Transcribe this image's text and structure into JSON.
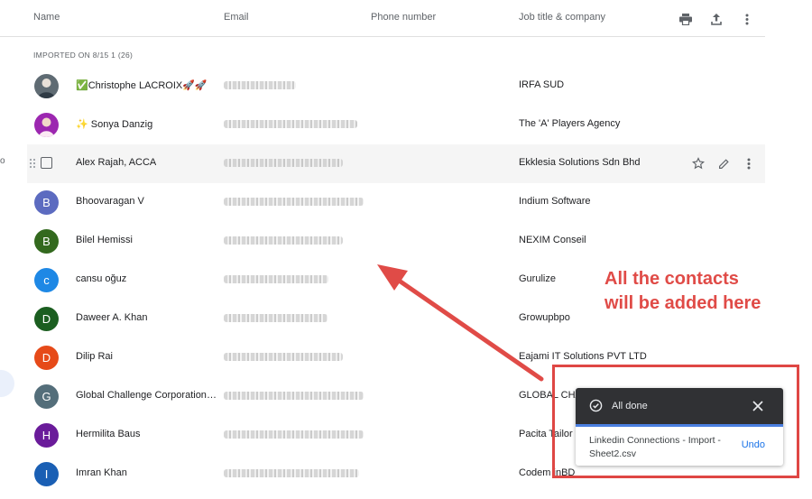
{
  "header": {
    "name": "Name",
    "email": "Email",
    "phone": "Phone number",
    "job": "Job title & company",
    "icons": [
      "print-icon",
      "export-icon",
      "more-vert-icon"
    ]
  },
  "section_label": "IMPORTED ON 8/15 1 (26)",
  "contacts": [
    {
      "initial": "",
      "name": "✅Christophe LACROIX🚀🚀",
      "job": "IRFA SUD",
      "avatar_color": "#5f6b73",
      "photo": true
    },
    {
      "initial": "",
      "name": "✨ Sonya Danzig",
      "job": "The 'A' Players Agency",
      "avatar_color": "#9c27b0",
      "photo": true
    },
    {
      "initial": "",
      "name": "Alex Rajah, ACCA",
      "job": "Ekklesia Solutions Sdn Bhd",
      "avatar_color": "",
      "photo": false
    },
    {
      "initial": "B",
      "name": "Bhoovaragan V",
      "job": "Indium Software",
      "avatar_color": "#5c6bc0"
    },
    {
      "initial": "B",
      "name": "Bilel Hemissi",
      "job": "NEXIM Conseil",
      "avatar_color": "#33691e"
    },
    {
      "initial": "c",
      "name": "cansu oğuz",
      "job": "Gurulize",
      "avatar_color": "#1e88e5"
    },
    {
      "initial": "D",
      "name": "Daweer A. Khan",
      "job": "Growupbpo",
      "avatar_color": "#1b5e20"
    },
    {
      "initial": "D",
      "name": "Dilip Rai",
      "job": "Eajami IT Solutions PVT LTD",
      "avatar_color": "#e64a19"
    },
    {
      "initial": "G",
      "name": "Global Challenge Corporation ...",
      "job": "GLOBAL CHA",
      "avatar_color": "#546e7a"
    },
    {
      "initial": "H",
      "name": "Hermilita Baus",
      "job": "Pacita Tailor",
      "avatar_color": "#6a1b9a"
    },
    {
      "initial": "I",
      "name": "Imran Khan",
      "job": "Codem inBD",
      "avatar_color": "#1a5fb4"
    }
  ],
  "annotation": {
    "line1": "All the contacts",
    "line2": "will be added here",
    "color": "#e04b47"
  },
  "toast": {
    "title": "All done",
    "message": "Linkedin Connections - Import - Sheet2.csv",
    "undo": "Undo"
  }
}
